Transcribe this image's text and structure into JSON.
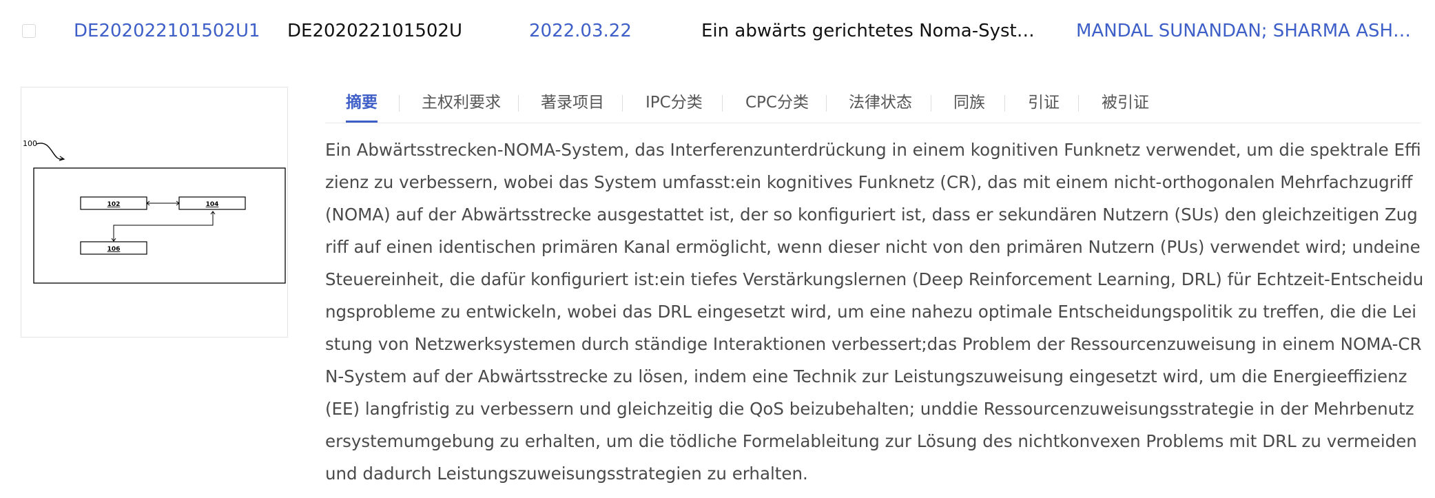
{
  "record": {
    "publication_number": "DE202022101502U1",
    "application_number": "DE202022101502U",
    "date": "2022.03.22",
    "title": "Ein abwärts gerichtetes Noma-System ...",
    "applicants": "MANDAL SUNANDAN; SHARMA ASHU..."
  },
  "drawing": {
    "ref_100": "100",
    "box_102": "102",
    "box_104": "104",
    "box_106": "106"
  },
  "tabs": [
    {
      "label": "摘要"
    },
    {
      "label": "主权利要求"
    },
    {
      "label": "著录项目"
    },
    {
      "label": "IPC分类"
    },
    {
      "label": "CPC分类"
    },
    {
      "label": "法律状态"
    },
    {
      "label": "同族"
    },
    {
      "label": "引证"
    },
    {
      "label": "被引证"
    }
  ],
  "abstract": "Ein Abwärtsstrecken-NOMA-System, das Interferenzunterdrückung in einem kognitiven Funknetz verwendet, um die spektrale Effizienz zu verbessern, wobei das System umfasst:ein kognitives Funknetz (CR), das mit einem nicht-orthogonalen Mehrfachzugriff (NOMA) auf der Abwärtsstrecke ausgestattet ist, der so konfiguriert ist, dass er sekundären Nutzern (SUs) den gleichzeitigen Zugriff auf einen identischen primären Kanal ermöglicht, wenn dieser nicht von den primären Nutzern (PUs) verwendet wird; undeine Steuereinheit, die dafür konfiguriert ist:ein tiefes Verstärkungslernen (Deep Reinforcement Learning, DRL) für Echtzeit-Entscheidungsprobleme zu entwickeln, wobei das DRL eingesetzt wird, um eine nahezu optimale Entscheidungspolitik zu treffen, die die Leistung von Netzwerksystemen durch ständige Interaktionen verbessert;das Problem der Ressourcenzuweisung in einem NOMA-CRN-System auf der Abwärtsstrecke zu lösen, indem eine Technik zur Leistungszuweisung eingesetzt wird, um die Energieeffizienz (EE) langfristig zu verbessern und gleichzeitig die QoS beizubehalten; unddie Ressourcenzuweisungsstrategie in der Mehrbenutzersystemumgebung zu erhalten, um die tödliche Formelableitung zur Lösung des nichtkonvexen Problems mit DRL zu vermeiden und dadurch Leistungszuweisungsstrategien zu erhalten.",
  "colors": {
    "link": "#3e5fc8",
    "text": "#4a4a4a",
    "border": "#e3e3e3"
  }
}
